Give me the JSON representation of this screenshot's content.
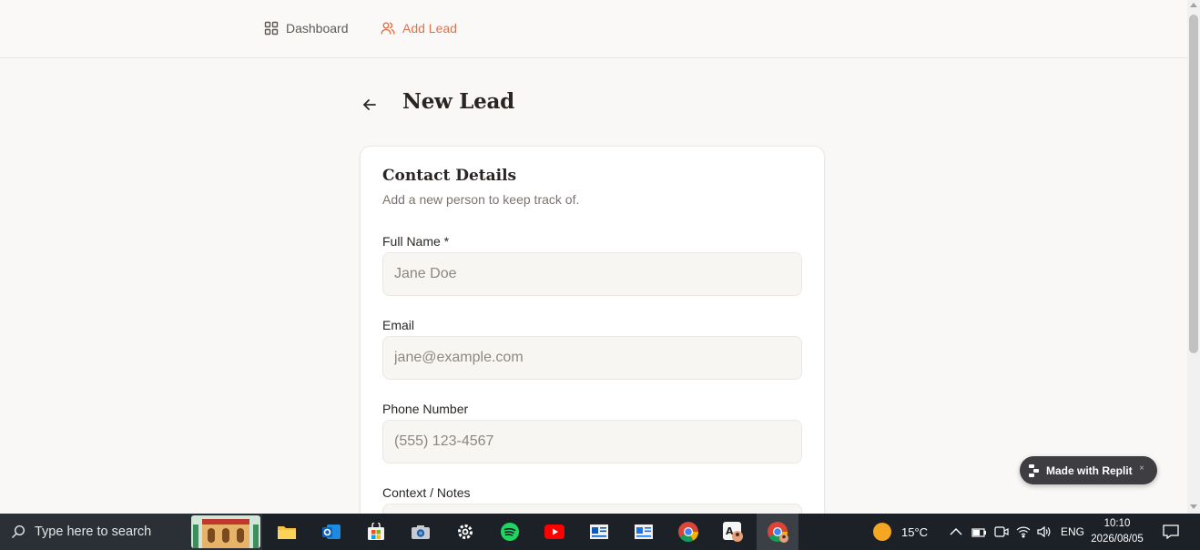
{
  "nav": {
    "items": [
      {
        "label": "Dashboard",
        "icon": "grid-icon"
      },
      {
        "label": "Add Lead",
        "icon": "users-icon",
        "active": true
      }
    ]
  },
  "page": {
    "title": "New Lead"
  },
  "card": {
    "title": "Contact Details",
    "subtitle": "Add a new person to keep track of.",
    "fields": [
      {
        "label": "Full Name *",
        "placeholder": "Jane Doe"
      },
      {
        "label": "Email",
        "placeholder": "jane@example.com"
      },
      {
        "label": "Phone Number",
        "placeholder": "(555) 123-4567"
      },
      {
        "label": "Context / Notes",
        "placeholder": ""
      }
    ]
  },
  "badge": {
    "label": "Made with Replit",
    "close": "×"
  },
  "taskbar": {
    "search_placeholder": "Type here to search",
    "weather": "15°C",
    "language": "ENG",
    "time": "10:10",
    "date": "2026/08/05"
  },
  "colors": {
    "accent": "#e0714b",
    "background": "#faf8f6",
    "taskbar": "#1c2027"
  }
}
